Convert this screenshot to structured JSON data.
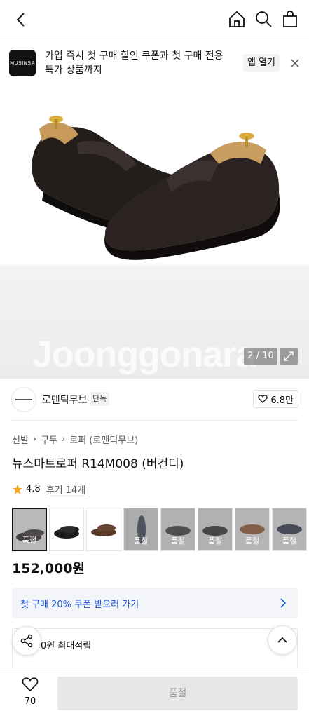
{
  "promo": {
    "logo_text": "MUSINSA",
    "message": "가입 즉시 첫 구매 할인 쿠폰과 첫 구매 전용 특가 상품까지",
    "open_app_label": "앱 열기"
  },
  "gallery": {
    "watermark": "Joonggonara",
    "counter": "2 / 10"
  },
  "brand": {
    "name": "로맨틱무브",
    "exclusive_badge": "단독",
    "like_count": "6.8만"
  },
  "breadcrumb": [
    "신발",
    "구두",
    "로퍼 (로맨틱무브)"
  ],
  "product": {
    "title": "뉴스마트로퍼 R14M008 (버건디)",
    "rating": "4.8",
    "reviews": "후기 14개",
    "price": "152,000원"
  },
  "thumbnails": [
    {
      "label": "품절",
      "color": "#2a2624"
    },
    {
      "label": "",
      "color": "#1e1c1c"
    },
    {
      "label": "",
      "color": "#5a3a2a"
    },
    {
      "label": "품절",
      "color": "#3a4050"
    },
    {
      "label": "품절",
      "color": "#3a3a3c"
    },
    {
      "label": "품절",
      "color": "#2e2c2d"
    },
    {
      "label": "품절",
      "color": "#8a5030"
    },
    {
      "label": "품절",
      "color": "#2b3345"
    }
  ],
  "coupon": {
    "label": "첫 구매 20% 쿠폰 받으러 가기"
  },
  "points": {
    "label": "0원 최대적립"
  },
  "bottom": {
    "favorite_count": "70",
    "buy_label": "품절"
  },
  "colors": {
    "accent_blue": "#1a56db",
    "star": "#f5a623"
  }
}
